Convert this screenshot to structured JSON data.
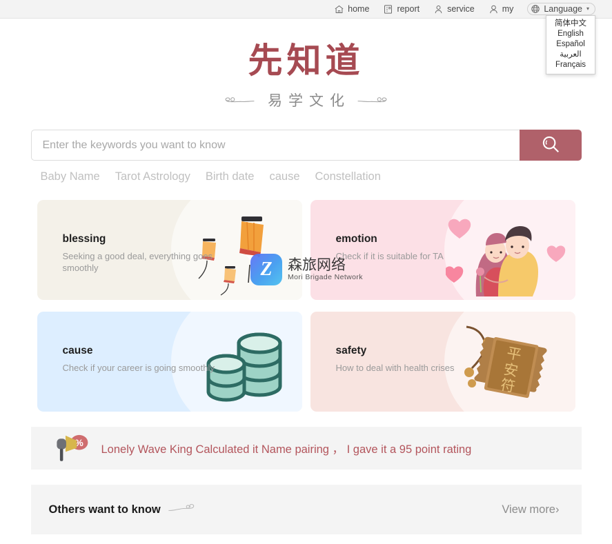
{
  "topnav": {
    "items": [
      {
        "label": "home",
        "icon": "home-icon"
      },
      {
        "label": "report",
        "icon": "report-icon"
      },
      {
        "label": "service",
        "icon": "service-icon"
      },
      {
        "label": "my",
        "icon": "user-icon"
      }
    ],
    "language_button": {
      "label": "Language",
      "icon": "globe-icon",
      "caret": "▾"
    },
    "language_menu": {
      "options": [
        "简体中文",
        "English",
        "Español",
        "العربية",
        "Français"
      ]
    }
  },
  "logo": {
    "main": "先知道",
    "sub": "易学文化",
    "color": "#a64a52"
  },
  "search": {
    "placeholder": "Enter the keywords you want to know",
    "value": "",
    "button_icon": "search-icon",
    "button_color": "#b0616a",
    "tags": [
      "Baby Name",
      "Tarot Astrology",
      "Birth date",
      "cause",
      "Constellation"
    ]
  },
  "cards": [
    {
      "title": "blessing",
      "desc": "Seeking a good deal, everything goes smoothly",
      "bg": "#f4f1e9",
      "art": "lantern-icon"
    },
    {
      "title": "emotion",
      "desc": "Check if it is suitable for TA",
      "bg": "#fce0e6",
      "art": "couple-hug-icon"
    },
    {
      "title": "cause",
      "desc": "Check if your career is going smoothly",
      "bg": "#ddeeff",
      "art": "coins-icon"
    },
    {
      "title": "safety",
      "desc": "How to deal with health crises",
      "bg": "#f8e4e0",
      "art": "amulet-icon"
    }
  ],
  "announcement": {
    "icon": "megaphone-percent-icon",
    "text": "Lonely Wave King Calculated it  Name pairing ，  I gave it a 95 point rating",
    "color": "#b3555c"
  },
  "others": {
    "title": "Others want to know",
    "ornament": "cloud-icon",
    "view_more": "View more",
    "view_more_caret": "›"
  },
  "watermark": {
    "mark": "Z",
    "cn": "森旅网络",
    "en": "Mori Brigade Network"
  }
}
